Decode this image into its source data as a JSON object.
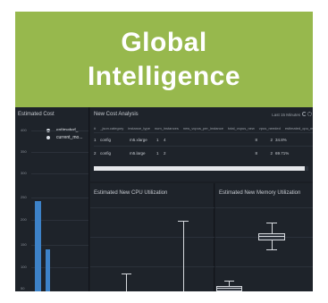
{
  "banner": {
    "line1": "Global",
    "line2": "Intelligence",
    "color": "#97b84d"
  },
  "cost_panel": {
    "title": "Estimated Cost",
    "legend": [
      {
        "label": "estimated_..."
      },
      {
        "label": "current_mo..."
      }
    ],
    "y_ticks": [
      "400",
      "350",
      "300",
      "250",
      "200",
      "150",
      "100",
      "50"
    ],
    "bars": [
      {
        "series": "estimated",
        "value": 0.56
      },
      {
        "series": "current",
        "value": 0.26
      }
    ],
    "bar_color": "#3d82c8"
  },
  "analysis_panel": {
    "title": "New Cost Analysis",
    "time_range": "Last 15 Minutes",
    "columns": [
      "#",
      "_json.category",
      "instance_type",
      "num_instances",
      "new_vcpus_per_instance",
      "total_vcpus_new",
      "vpus_needed",
      "estimated_cpu_max"
    ],
    "rows": [
      {
        "idx": "1",
        "category": "config",
        "type": "m5.xlarge",
        "num": "1",
        "vcpu": "4",
        "needed": "8",
        "est": "2",
        "pct": "34.8%"
      },
      {
        "idx": "2",
        "category": "config",
        "type": "m5.large",
        "num": "1",
        "vcpu": "2",
        "needed": "8",
        "est": "2",
        "pct": "69.71%"
      }
    ]
  },
  "cpu_panel": {
    "title": "Estimated New CPU Utilization"
  },
  "mem_panel": {
    "title": "Estimated New Memory Utilization"
  }
}
